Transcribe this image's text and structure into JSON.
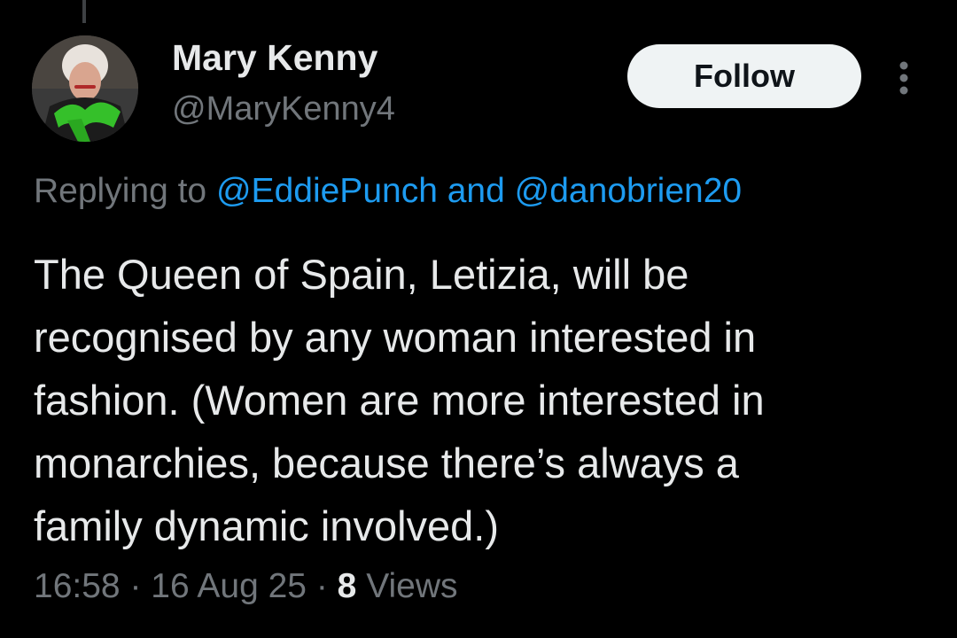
{
  "author": {
    "display_name": "Mary Kenny",
    "handle": "@MaryKenny4"
  },
  "follow_label": "Follow",
  "reply_context": {
    "prefix": "Replying to",
    "mention_1": "@EddiePunch",
    "conjunction": "and",
    "mention_2": "@danobrien20"
  },
  "tweet_text_lines": [
    "The Queen of Spain, Letizia, will be",
    "recognised by any woman interested in",
    "fashion. (Women are more interested in",
    "monarchies, because there’s always a",
    "family dynamic involved.)"
  ],
  "meta": {
    "time": "16:58",
    "separator": "·",
    "date": "16 Aug 25",
    "views_count": "8",
    "views_label": "Views"
  },
  "icons": {
    "more": "more-vertical-icon",
    "avatar": "profile-photo"
  },
  "colors": {
    "background": "#000000",
    "primary_text": "#e7e9ea",
    "secondary_text": "#71767b",
    "link": "#1d9bf0",
    "follow_bg": "#eff3f4"
  }
}
